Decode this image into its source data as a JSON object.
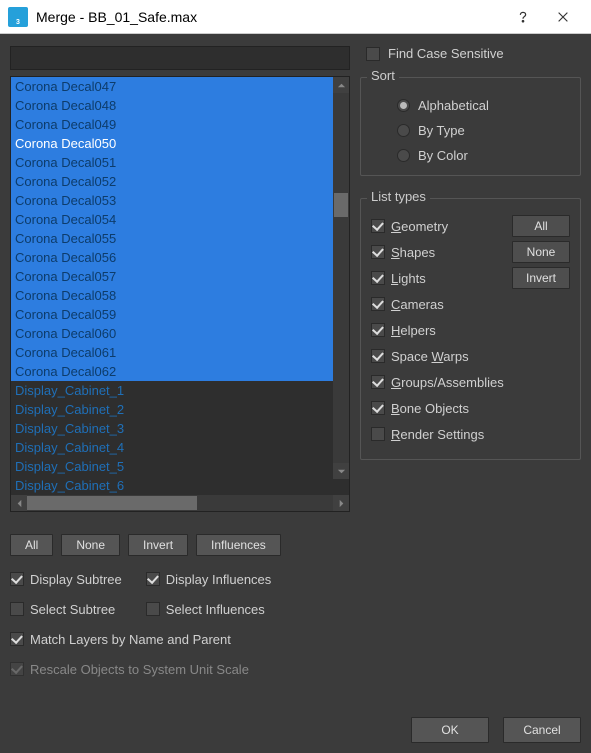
{
  "title": "Merge - BB_01_Safe.max",
  "list_items": [
    {
      "label": "Corona Decal047",
      "sel": true
    },
    {
      "label": "Corona Decal048",
      "sel": true
    },
    {
      "label": "Corona Decal049",
      "sel": true
    },
    {
      "label": "Corona Decal050",
      "sel": true,
      "focus": true
    },
    {
      "label": "Corona Decal051",
      "sel": true
    },
    {
      "label": "Corona Decal052",
      "sel": true
    },
    {
      "label": "Corona Decal053",
      "sel": true
    },
    {
      "label": "Corona Decal054",
      "sel": true
    },
    {
      "label": "Corona Decal055",
      "sel": true
    },
    {
      "label": "Corona Decal056",
      "sel": true
    },
    {
      "label": "Corona Decal057",
      "sel": true
    },
    {
      "label": "Corona Decal058",
      "sel": true
    },
    {
      "label": "Corona Decal059",
      "sel": true
    },
    {
      "label": "Corona Decal060",
      "sel": true
    },
    {
      "label": "Corona Decal061",
      "sel": true
    },
    {
      "label": "Corona Decal062",
      "sel": true
    },
    {
      "label": "Display_Cabinet_1",
      "sel": false
    },
    {
      "label": "Display_Cabinet_2",
      "sel": false
    },
    {
      "label": "Display_Cabinet_3",
      "sel": false
    },
    {
      "label": "Display_Cabinet_4",
      "sel": false
    },
    {
      "label": "Display_Cabinet_5",
      "sel": false
    },
    {
      "label": "Display_Cabinet_6",
      "sel": false
    }
  ],
  "find": {
    "case_sensitive_label": "Find Case Sensitive",
    "checked": false
  },
  "sort": {
    "title": "Sort",
    "options": [
      "Alphabetical",
      "By Type",
      "By Color"
    ],
    "selected": 0
  },
  "list_types": {
    "title": "List types",
    "buttons": {
      "all": "All",
      "none": "None",
      "invert": "Invert"
    },
    "items": [
      {
        "ul": "G",
        "rest": "eometry",
        "checked": true
      },
      {
        "ul": "S",
        "rest": "hapes",
        "checked": true
      },
      {
        "ul": "L",
        "rest": "ights",
        "checked": true
      },
      {
        "ul": "C",
        "rest": "ameras",
        "checked": true
      },
      {
        "ul": "H",
        "rest": "elpers",
        "checked": true
      },
      {
        "pre": "Space ",
        "ul": "W",
        "rest": "arps",
        "checked": true
      },
      {
        "ul": "G",
        "rest": "roups/Assemblies",
        "checked": true
      },
      {
        "ul": "B",
        "rest": "one Objects",
        "checked": true
      },
      {
        "ul": "R",
        "rest": "ender Settings",
        "checked": false
      }
    ]
  },
  "buttons": {
    "all": "All",
    "none": "None",
    "invert": "Invert",
    "influences": "Influences",
    "ok": "OK",
    "cancel": "Cancel"
  },
  "checks": {
    "display_subtree": {
      "label": "Display Subtree",
      "checked": true
    },
    "display_influences": {
      "label": "Display Influences",
      "checked": true
    },
    "select_subtree": {
      "label": "Select Subtree",
      "checked": false
    },
    "select_influences": {
      "label": "Select Influences",
      "checked": false
    },
    "match_layers": {
      "label": "Match Layers by Name and Parent",
      "checked": true
    },
    "rescale": {
      "label": "Rescale Objects to System Unit Scale",
      "checked": true,
      "disabled": true
    }
  }
}
